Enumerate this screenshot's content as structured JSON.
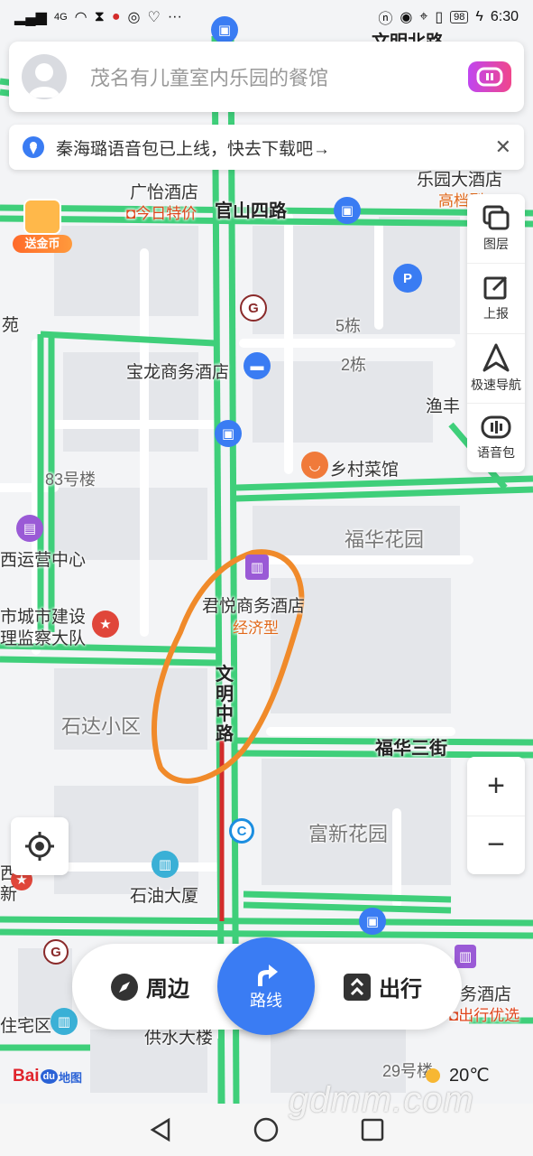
{
  "status_bar": {
    "signal": "4G",
    "battery": "98",
    "time": "6:30"
  },
  "search": {
    "placeholder": "茂名有儿童室内乐园的餐馆"
  },
  "notice": {
    "text": "秦海璐语音包已上线，快去下载吧→"
  },
  "promo": {
    "label": "送金币"
  },
  "toolbar": {
    "items": [
      {
        "label": "图层",
        "icon": "layers-icon"
      },
      {
        "label": "上报",
        "icon": "report-edit-icon"
      },
      {
        "label": "极速导航",
        "icon": "navigation-arrow-icon"
      },
      {
        "label": "语音包",
        "icon": "voice-pack-icon"
      }
    ]
  },
  "map": {
    "labels": {
      "wenming_north": "文明北路",
      "guangyi_hotel": "广怡酒店",
      "today_special": "今日特价",
      "guanshan4": "官山四路",
      "leyuan_hotel": "乐园大酒店",
      "high_grade": "高档型",
      "garden_yuan": "苑",
      "building5": "5栋",
      "building2": "2栋",
      "baolong_hotel": "宝龙商务酒店",
      "yufeng": "渔丰",
      "b83": "83号楼",
      "xiangcun": "乡村菜馆",
      "xiyun_center": "西运营中心",
      "fuhua_garden": "福华花园",
      "city_construction": "市城市建设",
      "supervision": "理监察大队",
      "junyue_hotel": "君悦商务酒店",
      "economy": "经济型",
      "shida_district": "石达小区",
      "fuhua3": "福华三街",
      "fuxin_garden": "富新花园",
      "shiyou_building": "石油大厦",
      "residential": "住宅区",
      "gongshui": "供水大楼",
      "business_hotel": "务酒店",
      "travel_pick": "出行优选",
      "b29": "29号楼",
      "left_edge1": "西",
      "left_edge2": "新"
    },
    "vertical_road": [
      "文",
      "明",
      "中",
      "路"
    ]
  },
  "zoom": {
    "in": "+",
    "out": "−"
  },
  "bottom": {
    "nearby": "周边",
    "route": "路线",
    "travel": "出行"
  },
  "logo": {
    "text": "Bai",
    "du": "du",
    "suffix": "地图"
  },
  "weather": {
    "temp": "20℃"
  },
  "watermark": "gdmm.com",
  "colors": {
    "road_green": "#3fcf7a",
    "route_blue": "#3a7cf3",
    "annotation": "#f08a2a"
  }
}
